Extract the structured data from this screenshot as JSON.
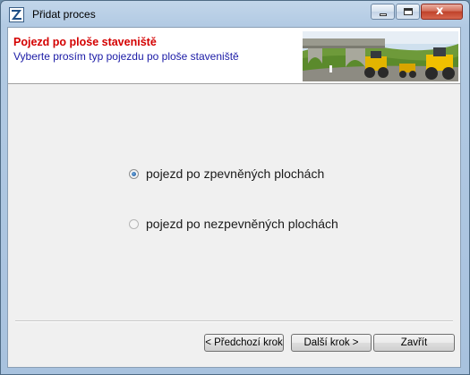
{
  "window": {
    "title": "Přidat proces",
    "close_glyph": "x"
  },
  "header": {
    "title": "Pojezd po ploše staveniště",
    "subtitle": "Vyberte prosím typ pojezdu po ploše staveniště",
    "image_icon": "construction-site-image"
  },
  "options": [
    {
      "label": "pojezd po zpevněných plochách",
      "checked": true
    },
    {
      "label": "pojezd po nezpevněných plochách",
      "checked": false
    }
  ],
  "buttons": {
    "prev": "< Předchozí krok",
    "next": "Další krok >",
    "close": "Zavřít"
  },
  "colors": {
    "header_title": "#d40000",
    "header_subtitle": "#1a1aa6"
  }
}
